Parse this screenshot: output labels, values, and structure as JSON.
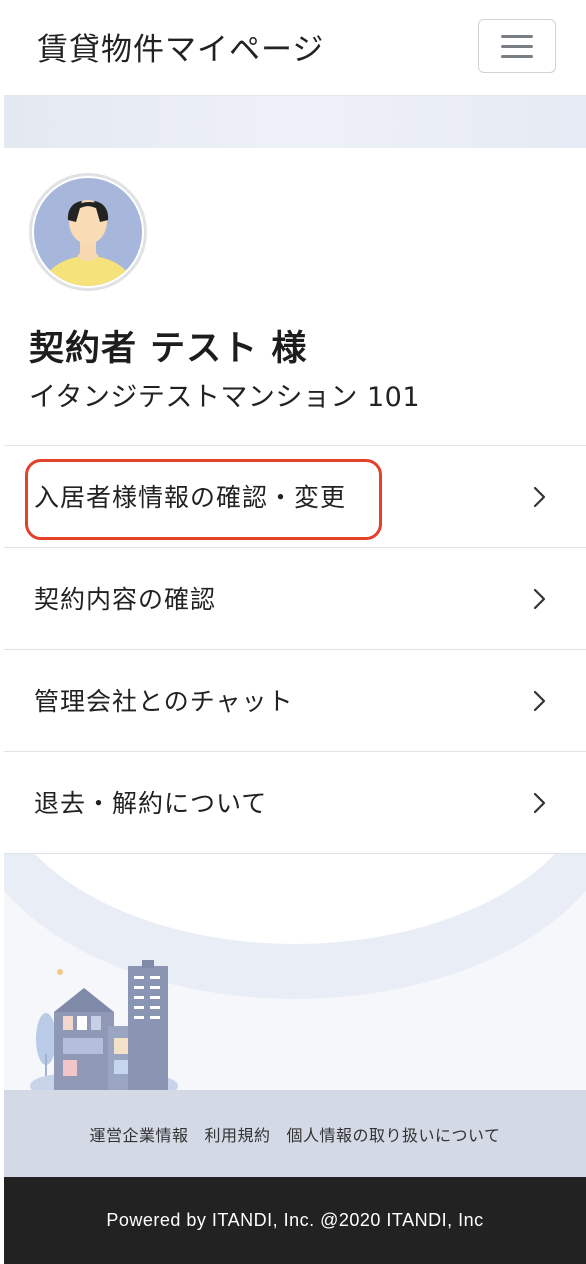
{
  "header": {
    "title": "賃貸物件マイページ",
    "menu_icon": "hamburger-icon"
  },
  "profile": {
    "avatar_icon": "user-avatar-icon",
    "name": "契約者 テスト 様",
    "property": "イタンジテストマンション 101"
  },
  "menu": {
    "items": [
      {
        "label": "入居者様情報の確認・変更",
        "icon": "chevron-right-icon",
        "highlighted": true,
        "highlight_color": "#e3412b"
      },
      {
        "label": "契約内容の確認",
        "icon": "chevron-right-icon"
      },
      {
        "label": "管理会社とのチャット",
        "icon": "chevron-right-icon"
      },
      {
        "label": "退去・解約について",
        "icon": "chevron-right-icon"
      }
    ]
  },
  "footer": {
    "links": [
      "運営企業情報",
      "利用規約",
      "個人情報の取り扱いについて"
    ],
    "copyright": "Powered by ITANDI, Inc. @2020 ITANDI, Inc"
  },
  "colors": {
    "accent_highlight": "#e3412b",
    "footer_bg": "#222222",
    "footer_links_bg": "#d3d9e5"
  }
}
